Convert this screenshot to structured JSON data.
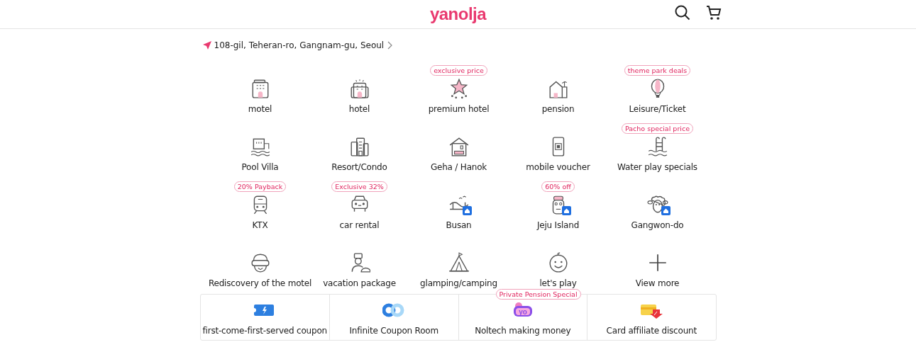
{
  "header": {
    "logo": "yanolja"
  },
  "location": {
    "address": "108-gil, Teheran-ro, Gangnam-gu, Seoul"
  },
  "categories": [
    {
      "label": "motel",
      "home_badge": false
    },
    {
      "label": "hotel",
      "home_badge": false
    },
    {
      "label": "premium hotel",
      "badge": "exclusive price",
      "home_badge": false
    },
    {
      "label": "pension",
      "home_badge": false
    },
    {
      "label": "Leisure/Ticket",
      "badge": "theme park deals",
      "home_badge": false
    },
    {
      "label": "Pool Villa",
      "home_badge": false
    },
    {
      "label": "Resort/Condo",
      "home_badge": false
    },
    {
      "label": "Geha / Hanok",
      "home_badge": false
    },
    {
      "label": "mobile voucher",
      "home_badge": false
    },
    {
      "label": "Water play specials",
      "badge": "Pacho special price",
      "home_badge": false
    },
    {
      "label": "KTX",
      "badge": "20% Payback",
      "home_badge": false
    },
    {
      "label": "car rental",
      "badge": "Exclusive 32%",
      "home_badge": false
    },
    {
      "label": "Busan",
      "home_badge": true
    },
    {
      "label": "Jeju Island",
      "badge": "60% off",
      "home_badge": true
    },
    {
      "label": "Gangwon-do",
      "home_badge": true
    },
    {
      "label": "Rediscovery of the motel",
      "home_badge": false
    },
    {
      "label": "vacation package",
      "home_badge": false
    },
    {
      "label": "glamping/camping",
      "home_badge": false
    },
    {
      "label": "let's play",
      "home_badge": false
    },
    {
      "label": "View more",
      "home_badge": false
    }
  ],
  "benefits": [
    {
      "label": "first-come-first-served coupon"
    },
    {
      "label": "Infinite Coupon Room"
    },
    {
      "label": "Noltech making money",
      "badge": "Private Pension Special",
      "icon_text": "yo"
    },
    {
      "label": "Card affiliate discount"
    }
  ]
}
